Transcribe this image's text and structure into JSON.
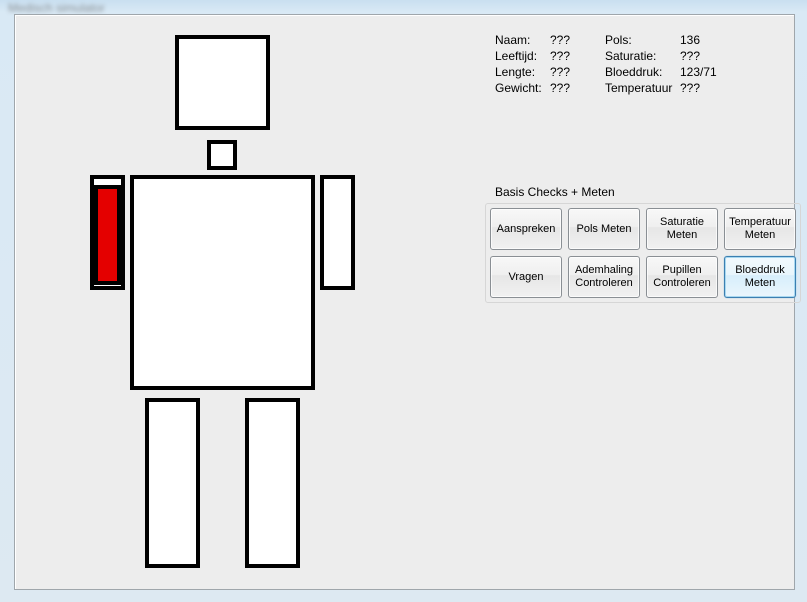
{
  "window": {
    "title": "Medisch simulator"
  },
  "patient": {
    "labels": {
      "naam": "Naam:",
      "leeftijd": "Leeftijd:",
      "lengte": "Lengte:",
      "gewicht": "Gewicht:",
      "pols": "Pols:",
      "saturatie": "Saturatie:",
      "bloeddruk": "Bloeddruk:",
      "temperatuur": "Temperatuur"
    },
    "values": {
      "naam": "???",
      "leeftijd": "???",
      "lengte": "???",
      "gewicht": "???",
      "pols": "136",
      "saturatie": "???",
      "bloeddruk": "123/71",
      "temperatuur": "???"
    }
  },
  "buttons": {
    "group_label": "Basis Checks + Meten",
    "items": [
      {
        "label": "Aanspreken",
        "active": false
      },
      {
        "label": "Pols Meten",
        "active": false
      },
      {
        "label": "Saturatie Meten",
        "active": false
      },
      {
        "label": "Temperatuur Meten",
        "active": false
      },
      {
        "label": "Vragen",
        "active": false
      },
      {
        "label": "Ademhaling Controleren",
        "active": false
      },
      {
        "label": "Pupillen Controleren",
        "active": false
      },
      {
        "label": "Bloeddruk Meten",
        "active": true
      }
    ]
  },
  "figure": {
    "injured_part": "upper-arm-left",
    "injury_color": "#e40000"
  }
}
